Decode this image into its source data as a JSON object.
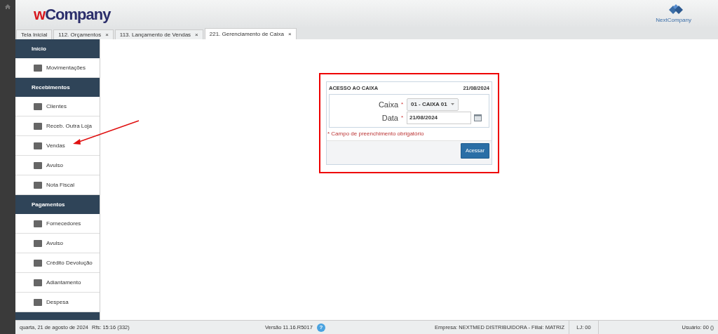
{
  "header": {
    "logo_accent": "w",
    "logo_text": "Company",
    "partner_logo": "NextCompany"
  },
  "tabs": [
    {
      "label": "Tela Inicial",
      "selected": false
    },
    {
      "label": "112. Orçamentos",
      "close": "×",
      "selected": false
    },
    {
      "label": "113. Lançamento de Vendas",
      "close": "×",
      "selected": false
    },
    {
      "label": "221. Gerenciamento de Caixa",
      "close": "×",
      "selected": true
    }
  ],
  "sidebar": {
    "sections": [
      {
        "title": "Início",
        "items": [
          "Movimentações"
        ]
      },
      {
        "title": "Recebimentos",
        "items": [
          "Clientes",
          "Receb. Outra Loja",
          "Vendas",
          "Avulso",
          "Nota Fiscal"
        ]
      },
      {
        "title": "Pagamentos",
        "items": [
          "Fornecedores",
          "Avulso",
          "Crédito Devolução",
          "Adiantamento",
          "Despesa"
        ]
      }
    ]
  },
  "dialog": {
    "title": "ACESSO AO CAIXA",
    "date": "21/08/2024",
    "fields": [
      {
        "kind": "select",
        "label": "Caixa",
        "required": "*",
        "value": "01 - CAIXA 01"
      },
      {
        "kind": "date",
        "label": "Data",
        "required": "*",
        "value": "21/08/2024"
      }
    ],
    "note": "* Campo de preenchimento obrigatório",
    "button": "Acessar"
  },
  "status_bar": {
    "date": "quarta, 21 de agosto de 2024",
    "refresh": "Rfs: 15:16 (332)",
    "version": "Versão 11.16.R5017",
    "help": "?",
    "company": "Empresa: NEXTMED DISTRIBUIDORA - Filial: MATRIZ",
    "store": "LJ: 00",
    "user": "Usuário: 00 ()"
  }
}
